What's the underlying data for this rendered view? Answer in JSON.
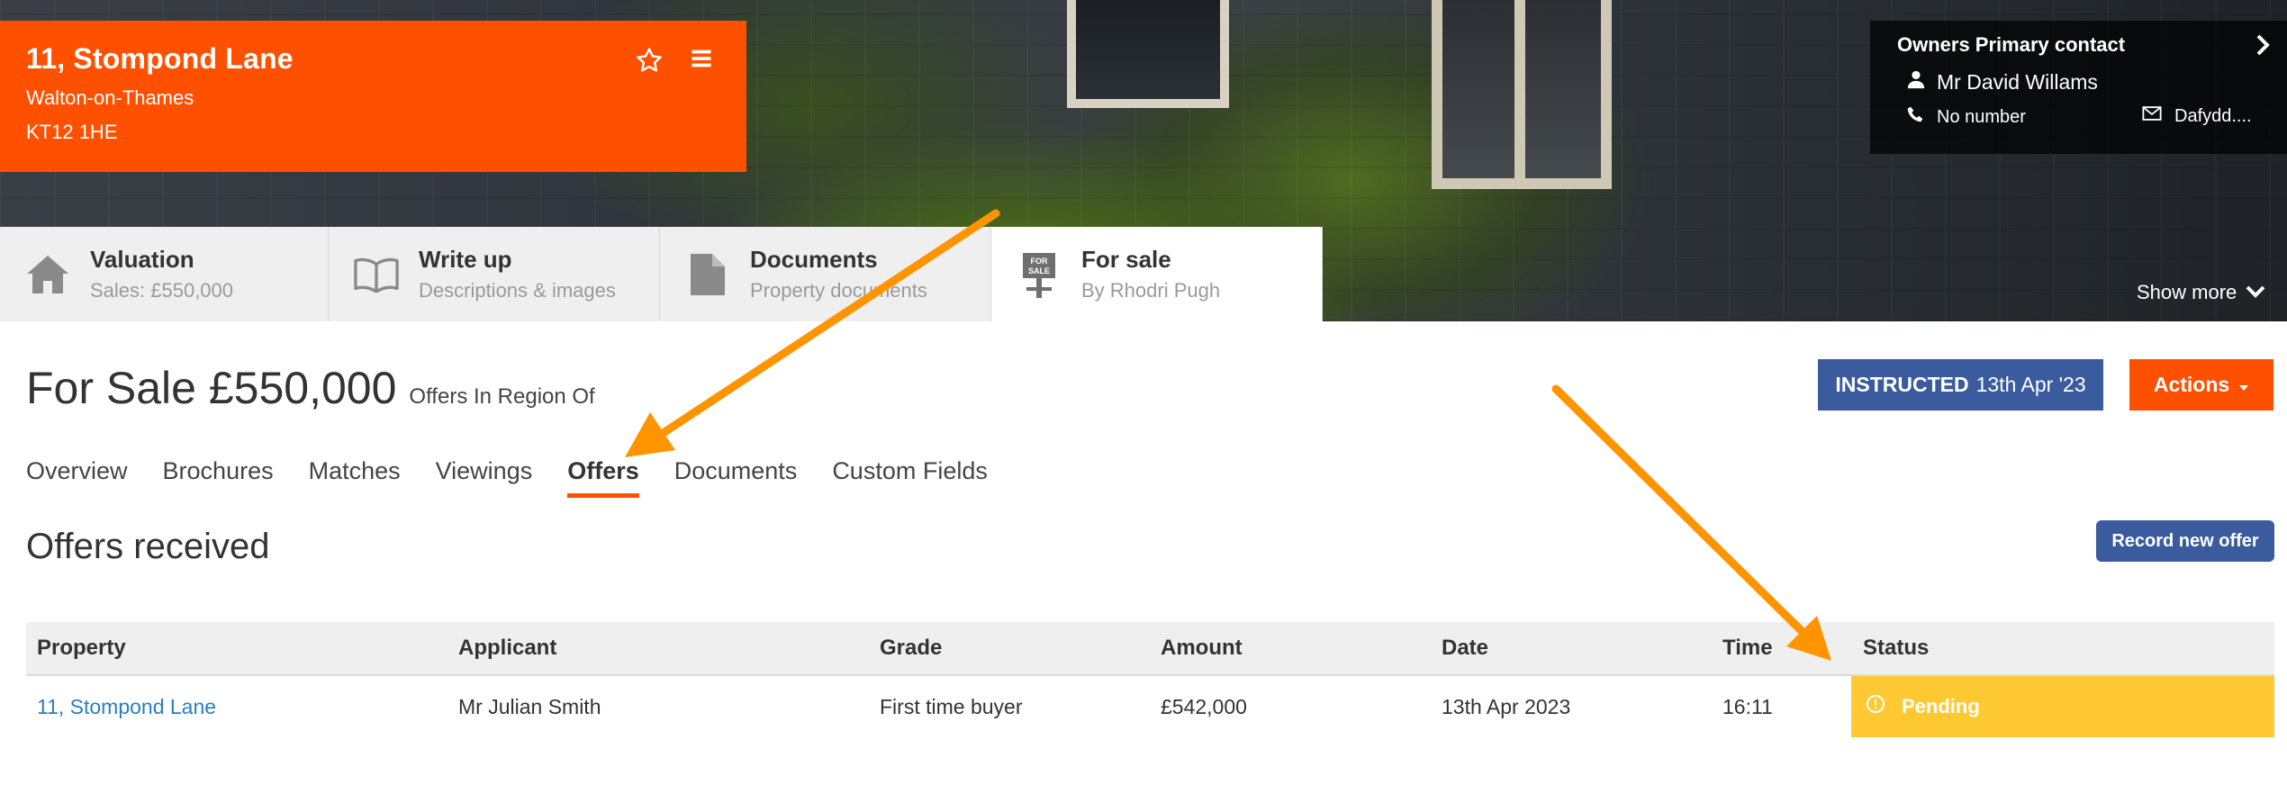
{
  "property": {
    "address_line1": "11, Stompond Lane",
    "town": "Walton-on-Thames",
    "postcode": "KT12 1HE"
  },
  "owner": {
    "title": "Owners Primary contact",
    "name": "Mr David Willams",
    "phone": "No number",
    "email": "Dafydd....",
    "show_more": "Show more"
  },
  "stages": [
    {
      "title": "Valuation",
      "subtitle": "Sales: £550,000",
      "icon": "house-icon"
    },
    {
      "title": "Write up",
      "subtitle": "Descriptions & images",
      "icon": "open-book-icon"
    },
    {
      "title": "Documents",
      "subtitle": "Property documents",
      "icon": "document-icon"
    },
    {
      "title": "For sale",
      "subtitle": "By Rhodri Pugh",
      "icon": "for-sale-sign-icon",
      "sign_text": [
        "FOR",
        "SALE"
      ]
    }
  ],
  "heading": {
    "price": "For Sale £550,000",
    "qualifier": "Offers In Region Of"
  },
  "instructed": {
    "label": "INSTRUCTED",
    "date": "13th Apr '23"
  },
  "actions_label": "Actions",
  "subtabs": [
    "Overview",
    "Brochures",
    "Matches",
    "Viewings",
    "Offers",
    "Documents",
    "Custom Fields"
  ],
  "active_subtab": "Offers",
  "offers": {
    "title": "Offers received",
    "record_button": "Record new offer",
    "columns": [
      "Property",
      "Applicant",
      "Grade",
      "Amount",
      "Date",
      "Time",
      "Status"
    ],
    "rows": [
      {
        "property": "11, Stompond Lane",
        "applicant": "Mr Julian Smith",
        "grade": "First time buyer",
        "amount": "£542,000",
        "date": "13th Apr 2023",
        "time": "16:11",
        "status": "Pending"
      }
    ]
  },
  "colors": {
    "brand_orange": "#ff5000",
    "accent_blue": "#3a5b9e",
    "pending_yellow": "#ffc933",
    "annotation_arrow": "#ff9400",
    "link_blue": "#2a7ec2"
  }
}
